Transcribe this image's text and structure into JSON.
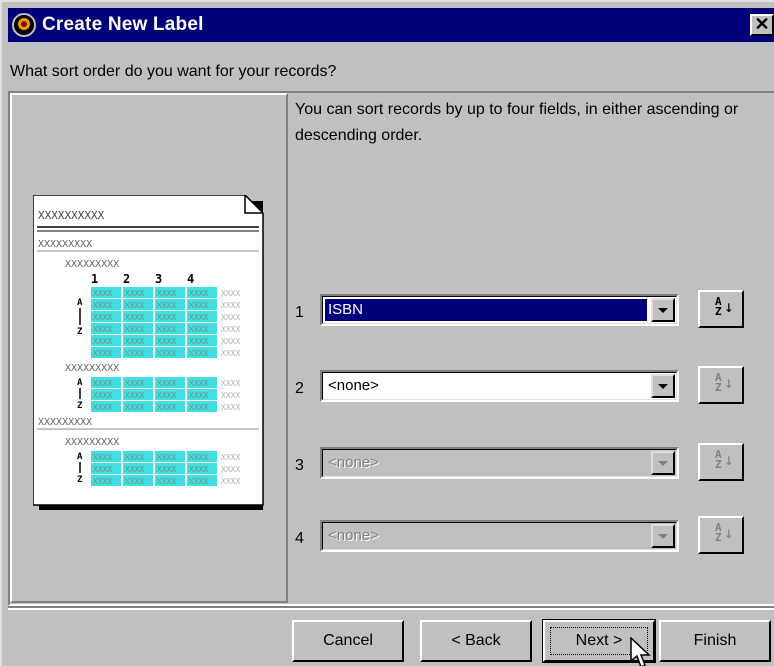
{
  "window": {
    "title": "Create New Label",
    "close_glyph": "✕",
    "icon": "app-logo-icon"
  },
  "prompt": "What sort order do you want for your records?",
  "instructions": "You can sort records by up to four fields, in either ascending or descending order.",
  "illustration": {
    "title_placeholder": "XXXXXXXXXX",
    "group_placeholder": "XXXXXXXXX",
    "subgroup_placeholder": "XXXXXXXXX",
    "columns": [
      "1",
      "2",
      "3",
      "4"
    ],
    "cell_text": "XXXX",
    "sort_glyph": "A↓Z"
  },
  "sort_fields": [
    {
      "number": "1",
      "value": "ISBN",
      "state": "selected",
      "direction_icon": "sort-ascending-icon"
    },
    {
      "number": "2",
      "value": "<none>",
      "state": "enabled",
      "direction_icon": "sort-ascending-icon"
    },
    {
      "number": "3",
      "value": "<none>",
      "state": "disabled",
      "direction_icon": "sort-ascending-icon"
    },
    {
      "number": "4",
      "value": "<none>",
      "state": "disabled",
      "direction_icon": "sort-ascending-icon"
    }
  ],
  "sort_dir_glyph": {
    "top": "A",
    "bottom": "Z",
    "arrow": "↓"
  },
  "buttons": {
    "cancel": "Cancel",
    "back": "< Back",
    "next": "Next >",
    "finish": "Finish"
  },
  "colors": {
    "face": "#c0c0c0",
    "title_bar": "#00007b",
    "selection": "#00007b",
    "highlight_cells": "#40e0e0"
  }
}
